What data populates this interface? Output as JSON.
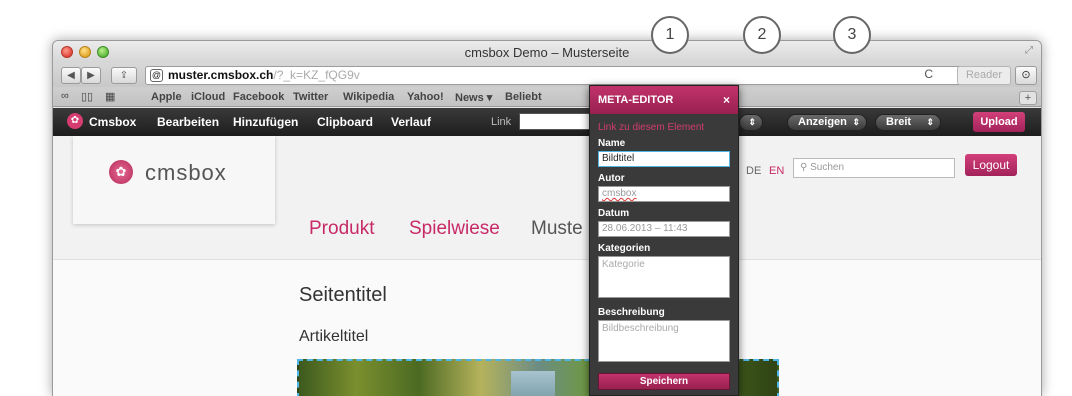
{
  "window": {
    "title": "cmsbox Demo – Musterseite"
  },
  "toolbar": {
    "back": "◀",
    "forward": "▶",
    "share": "⇪",
    "url_host": "muster.cmsbox.ch",
    "url_rest": "/?_k=KZ_fQG9v",
    "reload": "C",
    "reader": "Reader",
    "downloads": "⊙"
  },
  "bookmarks": {
    "icons": [
      "∞",
      "▯▯",
      "▦"
    ],
    "items": [
      "Apple",
      "iCloud",
      "Facebook",
      "Twitter",
      "Wikipedia",
      "Yahoo!",
      "News ▾",
      "Beliebt"
    ]
  },
  "cmsbar": {
    "brand": "Cmsbox",
    "items": [
      "Bearbeiten",
      "Hinzufügen",
      "Clipboard",
      "Verlauf"
    ],
    "link_label": "Link",
    "selects": [
      "Anzeigen",
      "Breit"
    ],
    "upload": "Upload"
  },
  "site": {
    "logo_text": "cmsbox",
    "lang_de": "DE",
    "lang_en": "EN",
    "search_placeholder": "Suchen",
    "logout": "Logout",
    "nav": [
      "Produkt",
      "Spielwiese",
      "Muste"
    ],
    "page_title": "Seitentitel",
    "article_title": "Artikeltitel"
  },
  "meta_editor": {
    "title": "META-EDITOR",
    "close": "×",
    "link_text": "Link zu diesem Element",
    "name_label": "Name",
    "name_value": "Bildtitel",
    "author_label": "Autor",
    "author_value": "cmsbox",
    "date_label": "Datum",
    "date_value": "28.06.2013 – 11:43",
    "categories_label": "Kategorien",
    "categories_placeholder": "Kategorie",
    "description_label": "Beschreibung",
    "description_placeholder": "Bildbeschreibung",
    "save": "Speichern"
  },
  "callouts": [
    "1",
    "2",
    "3"
  ],
  "colors": {
    "accent": "#c2326c",
    "selection": "#4fb4e6"
  }
}
